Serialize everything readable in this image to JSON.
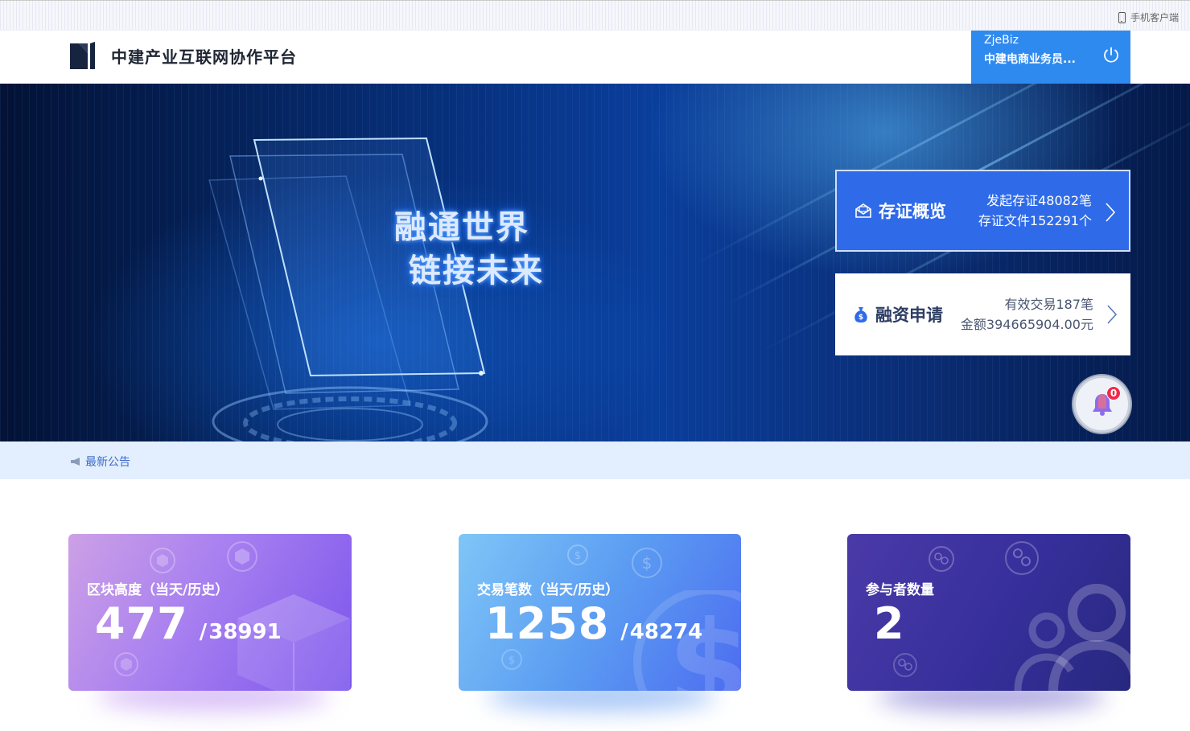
{
  "topbar": {
    "mobile_label": "手机客户端"
  },
  "header": {
    "site_title": "中建产业互联网协作平台",
    "user": {
      "name": "ZjeBiz",
      "company": "中建电商业务员..."
    }
  },
  "banner": {
    "slogan_line1": "融通世界",
    "slogan_line2": "链接未来",
    "cards": [
      {
        "title": "存证概览",
        "line1": "发起存证48082笔",
        "line2": "存证文件152291个"
      },
      {
        "title": "融资申请",
        "line1": "有效交易187笔",
        "line2": "金额394665904.00元"
      }
    ],
    "notification_count": "0"
  },
  "announcement": {
    "label": "最新公告"
  },
  "stats": [
    {
      "label": "区块高度（当天/历史）",
      "today": "477",
      "separator": "/",
      "history": "38991"
    },
    {
      "label": "交易笔数（当天/历史）",
      "today": "1258",
      "separator": "/",
      "history": "48274"
    },
    {
      "label": "参与者数量",
      "today": "2"
    }
  ],
  "colors": {
    "accent": "#2f8af0",
    "evidence_card": "#2f6be9",
    "announce_bg": "#e3efff",
    "badge": "#f02b4a"
  }
}
